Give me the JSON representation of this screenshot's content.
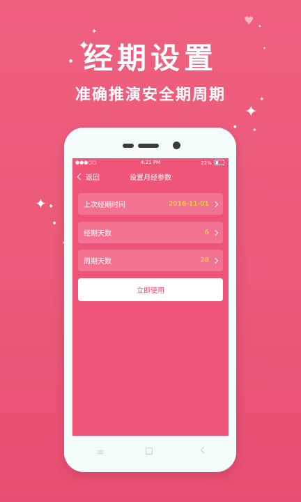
{
  "promo": {
    "title": "经期设置",
    "subtitle": "准确推演安全期周期"
  },
  "statusbar": {
    "signal": "●●●○○",
    "time": "4:21 PM",
    "battery": "22%"
  },
  "navbar": {
    "back_label": "返回",
    "title": "设置月经参数"
  },
  "settings": [
    {
      "label": "上次经期时间",
      "value": "2016-11-01"
    },
    {
      "label": "经期天数",
      "value": "6"
    },
    {
      "label": "周期天数",
      "value": "28"
    }
  ],
  "apply_button": "立即使用",
  "hw_nav": {
    "menu_glyph": "≡"
  },
  "colors": {
    "background": "#ec5a7a",
    "screen": "#ef5479",
    "value_accent": "#ffe14a",
    "phone_body": "#f4fbfb"
  }
}
